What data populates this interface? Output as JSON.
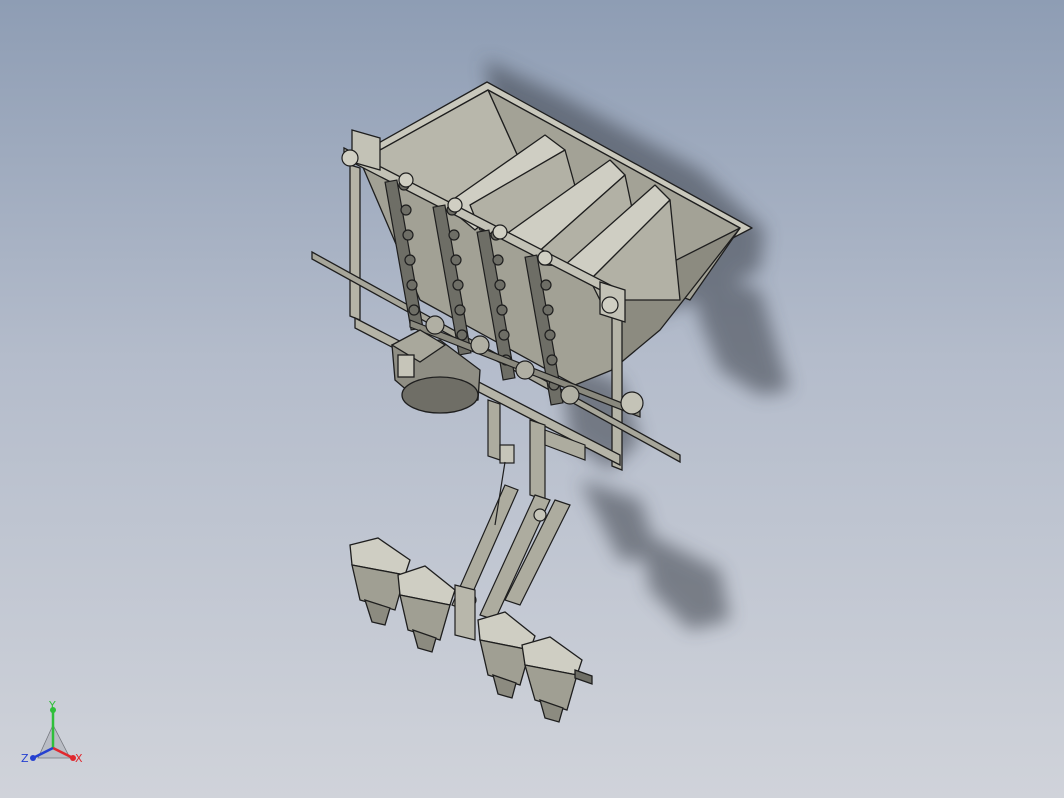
{
  "viewport": {
    "background_top": "#8e9db4",
    "background_bottom": "#d0d3da"
  },
  "model": {
    "body_color": "#a9a89a",
    "shade_color": "#7a7a6e",
    "edge_color": "#1e1e1e",
    "shadow_color": "#3a3f48"
  },
  "triad": {
    "x_label": "X",
    "y_label": "Y",
    "z_label": "Z",
    "x_color": "#e0282e",
    "y_color": "#2fbf3a",
    "z_color": "#2540d0"
  }
}
